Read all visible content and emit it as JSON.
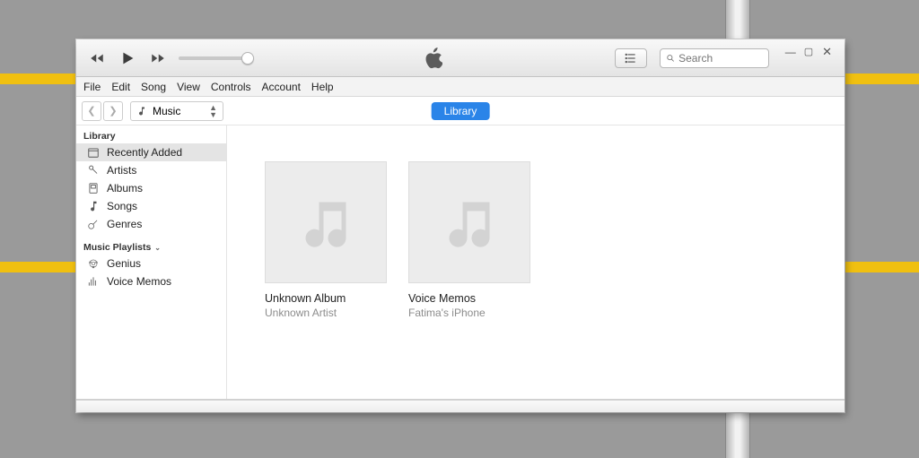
{
  "menu": [
    "File",
    "Edit",
    "Song",
    "View",
    "Controls",
    "Account",
    "Help"
  ],
  "music_dropdown": "Music",
  "tab_library": "Library",
  "search_placeholder": "Search",
  "sidebar": {
    "library_label": "Library",
    "items": [
      {
        "label": "Recently Added",
        "icon": "calendar"
      },
      {
        "label": "Artists",
        "icon": "mic"
      },
      {
        "label": "Albums",
        "icon": "album"
      },
      {
        "label": "Songs",
        "icon": "note"
      },
      {
        "label": "Genres",
        "icon": "guitar"
      }
    ],
    "playlists_label": "Music Playlists",
    "playlists": [
      {
        "label": "Genius",
        "icon": "genius"
      },
      {
        "label": "Voice Memos",
        "icon": "memos"
      }
    ]
  },
  "content": {
    "albums": [
      {
        "title": "Unknown Album",
        "subtitle": "Unknown Artist"
      },
      {
        "title": "Voice Memos",
        "subtitle": "Fatima's iPhone"
      }
    ]
  }
}
